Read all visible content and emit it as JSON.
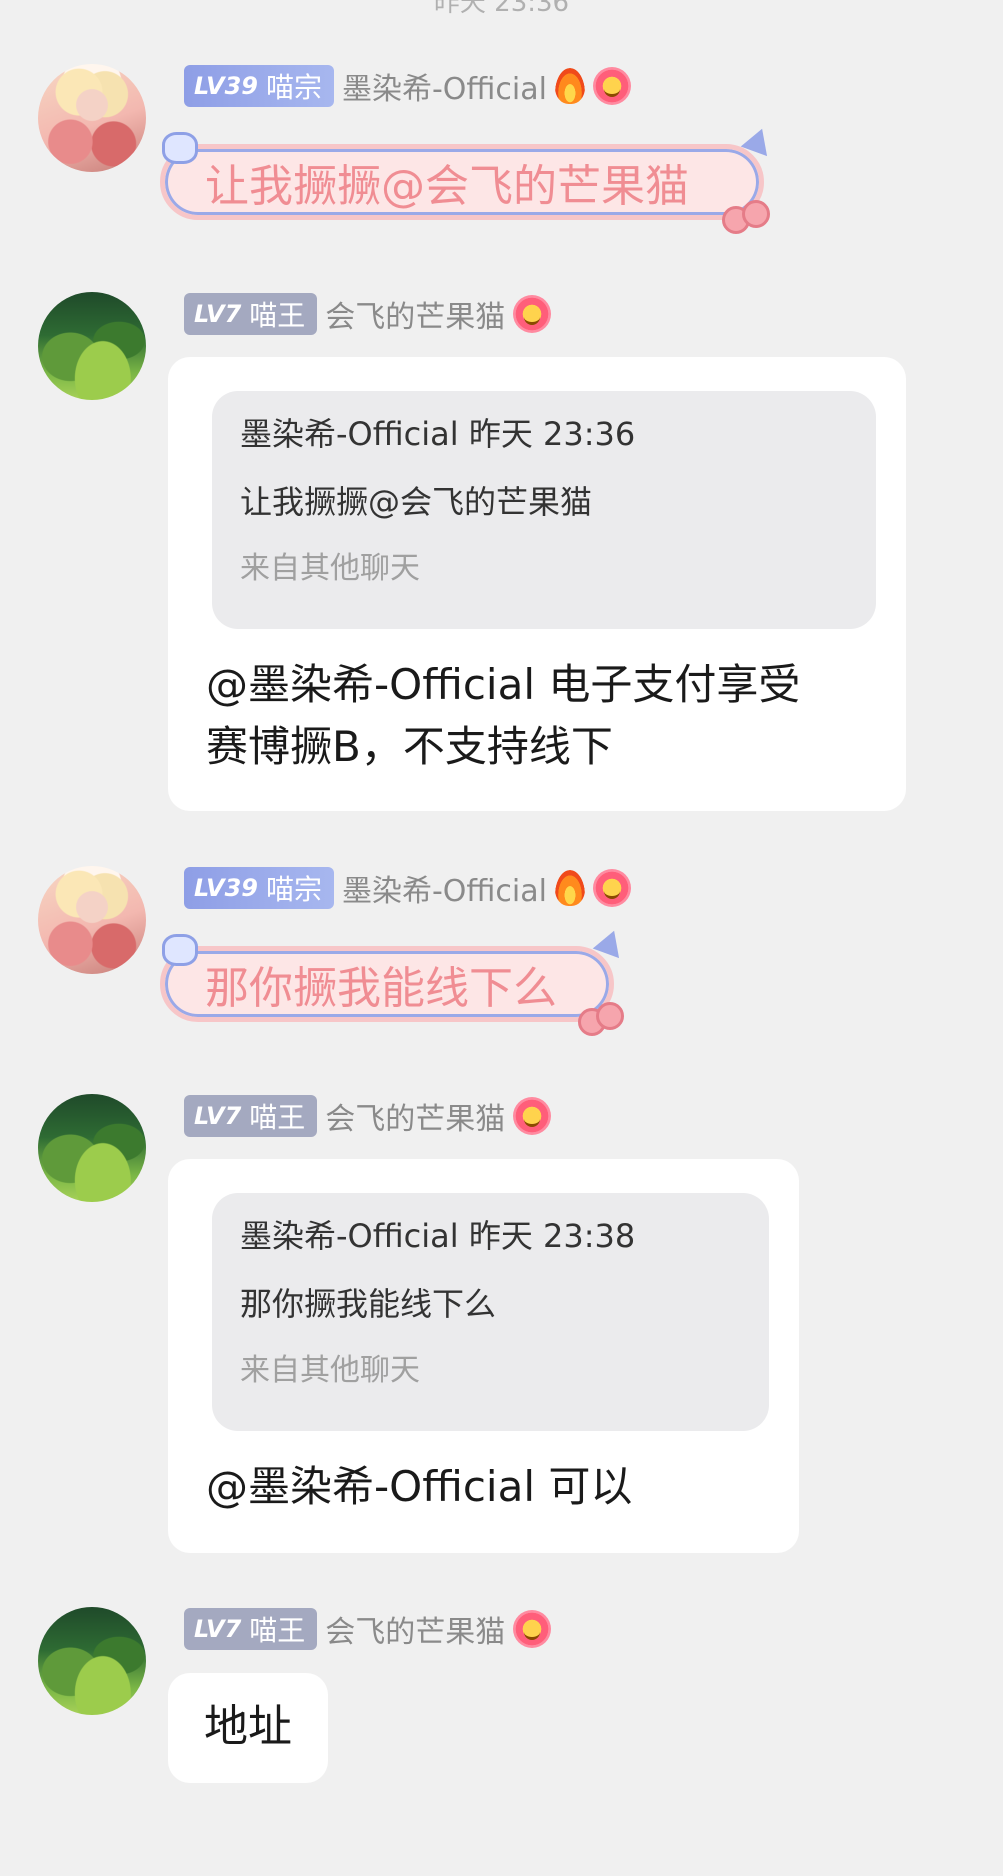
{
  "top_time": "昨天 23:36",
  "messages": [
    {
      "badge_lv": "LV39",
      "badge_title": "喵宗",
      "username": "墨染希-Official",
      "text": "让我撅撅@会飞的芒果猫"
    },
    {
      "badge_lv": "LV7",
      "badge_title": "喵王",
      "username": "会飞的芒果猫",
      "quote_head": "墨染希-Official 昨天 23:36",
      "quote_text": "让我撅撅@会飞的芒果猫",
      "quote_source": "来自其他聊天",
      "reply_line1": "@墨染希-Official 电子支付享受",
      "reply_line2": "赛博撅B，不支持线下"
    },
    {
      "badge_lv": "LV39",
      "badge_title": "喵宗",
      "username": "墨染希-Official",
      "text": "那你撅我能线下么"
    },
    {
      "badge_lv": "LV7",
      "badge_title": "喵王",
      "username": "会飞的芒果猫",
      "quote_head": "墨染希-Official 昨天 23:38",
      "quote_text": "那你撅我能线下么",
      "quote_source": "来自其他聊天",
      "reply_line1": "@墨染希-Official 可以"
    },
    {
      "badge_lv": "LV7",
      "badge_title": "喵王",
      "username": "会飞的芒果猫",
      "text": "地址"
    }
  ],
  "icons": {
    "fire": "fire-icon",
    "flower": "flower-emoji-icon",
    "avatar_a": "anime-girl-avatar",
    "avatar_b": "forest-landscape-avatar"
  },
  "colors": {
    "background": "#f0f0f0",
    "cute_bubble_fill": "#fde6e6",
    "cute_bubble_text": "#f08d93",
    "badge_high": "#8e9ee6",
    "badge_low": "#a4a9c0"
  }
}
